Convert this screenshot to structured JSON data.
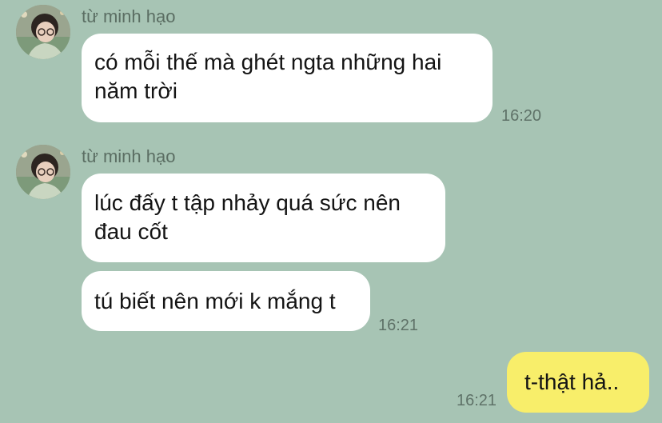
{
  "chat": {
    "groups": [
      {
        "sender": "từ minh hạo",
        "messages": [
          {
            "line1": "có mỗi thế mà ghét ngta những hai",
            "line2": "năm trời",
            "time": "16:20"
          }
        ]
      },
      {
        "sender": "từ minh hạo",
        "messages": [
          {
            "line1": "lúc đấy t tập nhảy quá sức nên",
            "line2": "đau cốt"
          },
          {
            "line1": "tú biết nên mới k mắng t",
            "time": "16:21"
          }
        ]
      }
    ],
    "outgoing": [
      {
        "text": "t-thật hả..",
        "time": "16:21"
      }
    ]
  },
  "colors": {
    "background": "#a7c4b4",
    "incoming_bubble": "#ffffff",
    "outgoing_bubble": "#f8ee6a",
    "sender_text": "#5b6e63",
    "time_text": "#5f7268"
  },
  "icons": {
    "avatar": "contact-avatar-photo"
  }
}
